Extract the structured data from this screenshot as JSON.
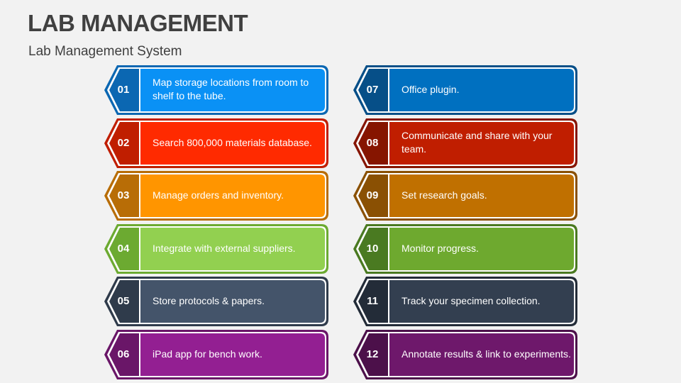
{
  "header": {
    "title": "LAB MANAGEMENT",
    "subtitle": "Lab Management System"
  },
  "items": [
    {
      "number": "01",
      "text": "Map storage locations from room to shelf to the tube.",
      "color": "#0A91F5",
      "dark": "#0B67B2",
      "outline": "#0B67B2"
    },
    {
      "number": "02",
      "text": "Search 800,000 materials database.",
      "color": "#FF2A00",
      "dark": "#C01E00",
      "outline": "#C01E00"
    },
    {
      "number": "03",
      "text": "Manage orders and inventory.",
      "color": "#FF9500",
      "dark": "#B86D06",
      "outline": "#B86D06"
    },
    {
      "number": "04",
      "text": "Integrate with external suppliers.",
      "color": "#92D050",
      "dark": "#6CAA31",
      "outline": "#6CAA31"
    },
    {
      "number": "05",
      "text": "Store protocols & papers.",
      "color": "#44546A",
      "dark": "#2F3B4B",
      "outline": "#2F3B4B"
    },
    {
      "number": "06",
      "text": "iPad app for bench work.",
      "color": "#931F92",
      "dark": "#6A1668",
      "outline": "#6A1668"
    },
    {
      "number": "07",
      "text": "Office plugin.",
      "color": "#0070C0",
      "dark": "#064F88",
      "outline": "#064F88"
    },
    {
      "number": "08",
      "text": "Communicate and share with your team.",
      "color": "#C01E00",
      "dark": "#861500",
      "outline": "#861500"
    },
    {
      "number": "09",
      "text": "Set research goals.",
      "color": "#C07000",
      "dark": "#8A5003",
      "outline": "#8A5003"
    },
    {
      "number": "10",
      "text": "Monitor progress.",
      "color": "#6EA92F",
      "dark": "#4A7A21",
      "outline": "#4A7A21"
    },
    {
      "number": "11",
      "text": "Track your specimen collection.",
      "color": "#333F50",
      "dark": "#232C38",
      "outline": "#232C38"
    },
    {
      "number": "12",
      "text": "Annotate results & link to experiments.",
      "color": "#6E186B",
      "dark": "#4C104A",
      "outline": "#4C104A"
    }
  ]
}
